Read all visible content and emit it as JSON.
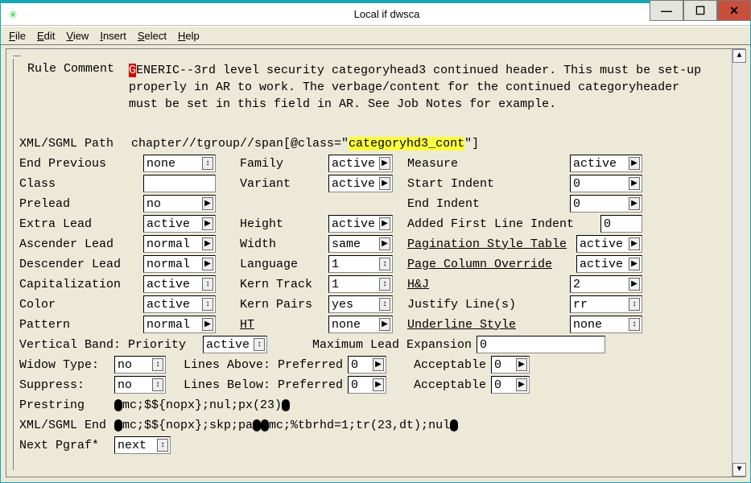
{
  "window": {
    "title": "Local if dwsca"
  },
  "menubar": [
    "File",
    "Edit",
    "View",
    "Insert",
    "Select",
    "Help"
  ],
  "fields": {
    "rule_comment_label": "Rule Comment",
    "rule_comment": "GENERIC--3rd level security categoryhead3 continued header. This must be set-up properly in AR to work. The verbage/content for the continued categoryheader must be set in this field in AR. See Job Notes for example.",
    "xml_path_label": "XML/SGML Path",
    "xml_path_pre": "chapter//tgroup//span[@class=\"",
    "xml_path_hl": "categoryhd3_cont",
    "xml_path_post": "\"]",
    "end_previous_label": "End Previous",
    "end_previous": "none",
    "class_label": "Class",
    "class": "",
    "prelead_label": "Prelead",
    "prelead": "no",
    "extra_lead_label": "Extra Lead",
    "extra_lead": "active",
    "ascender_label": "Ascender Lead",
    "ascender": "normal",
    "descender_label": "Descender Lead",
    "descender": "normal",
    "cap_label": "Capitalization",
    "cap": "active",
    "color_label": "Color",
    "color": "active",
    "pattern_label": "Pattern",
    "pattern": "normal",
    "family_label": "Family",
    "family": "active",
    "variant_label": "Variant",
    "variant": "active",
    "height_label": "Height",
    "height": "active",
    "width_label": "Width",
    "width": "same",
    "language_label": "Language",
    "language": "1",
    "kern_track_label": "Kern Track",
    "kern_track": "1",
    "kern_pairs_label": "Kern Pairs",
    "kern_pairs": "yes",
    "ht_label": "HT",
    "ht": "none",
    "measure_label": "Measure",
    "measure": "active",
    "start_indent_label": "Start Indent",
    "start_indent": "0",
    "end_indent_label": "End Indent",
    "end_indent": "0",
    "afli_label": "Added First Line Indent",
    "afli": "0",
    "pst_label": "Pagination Style Table",
    "pst": "active",
    "pco_label": "Page Column Override",
    "pco": "active",
    "hj_label": "H&J",
    "hj": "2",
    "justify_label": "Justify Line(s)",
    "justify": "rr",
    "ul_style_label": "Underline Style",
    "ul_style": "none",
    "vb_label": "Vertical Band: Priority",
    "vb": "active",
    "mle_label": "Maximum Lead Expansion",
    "mle": "0",
    "widow_label": "Widow Type:",
    "widow": "no",
    "lines_above_pref_label": "Lines Above: Preferred",
    "lines_above_pref": "0",
    "lines_above_acc_label": "Acceptable",
    "lines_above_acc": "0",
    "suppress_label": "Suppress:",
    "suppress": "no",
    "lines_below_pref_label": "Lines Below: Preferred",
    "lines_below_pref": "0",
    "lines_below_acc_label": "Acceptable",
    "lines_below_acc": "0",
    "prestring_label": "Prestring",
    "prestring": "mc;$${nopx};nul;px(23)",
    "xml_end_label": "XML/SGML End",
    "xml_end_a": "mc;$${nopx};skp;pa",
    "xml_end_b": "mc;%tbrhd=1;tr(23,dt);nul",
    "next_pgraf_label": "Next Pgraf*",
    "next_pgraf": "next"
  }
}
